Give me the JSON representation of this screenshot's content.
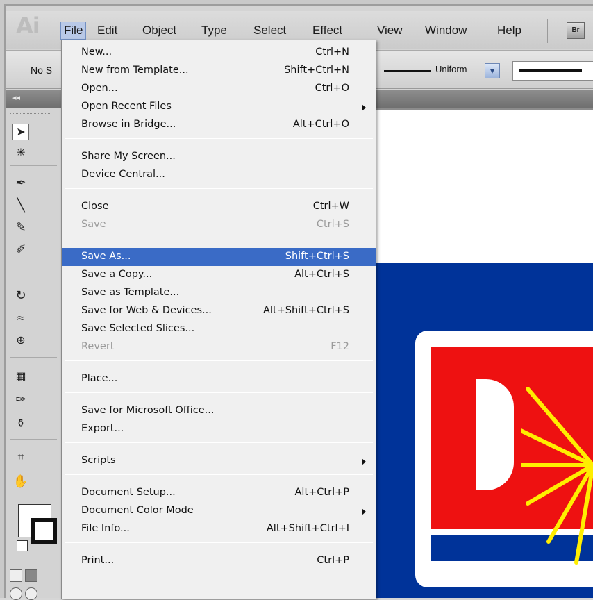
{
  "app": {
    "logo": "Ai"
  },
  "menubar": {
    "items": [
      "File",
      "Edit",
      "Object",
      "Type",
      "Select",
      "Effect",
      "View",
      "Window",
      "Help"
    ],
    "bridge_button": "Br"
  },
  "controlbar": {
    "selection_label": "No S",
    "stroke_profile": "Uniform"
  },
  "file_menu": {
    "items": [
      {
        "label": "New...",
        "shortcut": "Ctrl+N"
      },
      {
        "label": "New from Template...",
        "shortcut": "Shift+Ctrl+N"
      },
      {
        "label": "Open...",
        "shortcut": "Ctrl+O"
      },
      {
        "label": "Open Recent Files",
        "shortcut": ""
      },
      {
        "label": "Browse in Bridge...",
        "shortcut": "Alt+Ctrl+O"
      },
      {
        "label": "Share My Screen...",
        "shortcut": ""
      },
      {
        "label": "Device Central...",
        "shortcut": ""
      },
      {
        "label": "Close",
        "shortcut": "Ctrl+W"
      },
      {
        "label": "Save",
        "shortcut": "Ctrl+S"
      },
      {
        "label": "Save As...",
        "shortcut": "Shift+Ctrl+S"
      },
      {
        "label": "Save a Copy...",
        "shortcut": "Alt+Ctrl+S"
      },
      {
        "label": "Save as Template...",
        "shortcut": ""
      },
      {
        "label": "Save for Web & Devices...",
        "shortcut": "Alt+Shift+Ctrl+S"
      },
      {
        "label": "Save Selected Slices...",
        "shortcut": ""
      },
      {
        "label": "Revert",
        "shortcut": "F12"
      },
      {
        "label": "Place...",
        "shortcut": ""
      },
      {
        "label": "Save for Microsoft Office...",
        "shortcut": ""
      },
      {
        "label": "Export...",
        "shortcut": ""
      },
      {
        "label": "Scripts",
        "shortcut": ""
      },
      {
        "label": "Document Setup...",
        "shortcut": "Alt+Ctrl+P"
      },
      {
        "label": "Document Color Mode",
        "shortcut": ""
      },
      {
        "label": "File Info...",
        "shortcut": "Alt+Shift+Ctrl+I"
      },
      {
        "label": "Print...",
        "shortcut": "Ctrl+P"
      }
    ]
  },
  "colors": {
    "menu_highlight": "#3a6bc6",
    "canvas_blue": "#003399",
    "logo_red": "#ee1111",
    "burst_yellow": "#ffee00"
  }
}
